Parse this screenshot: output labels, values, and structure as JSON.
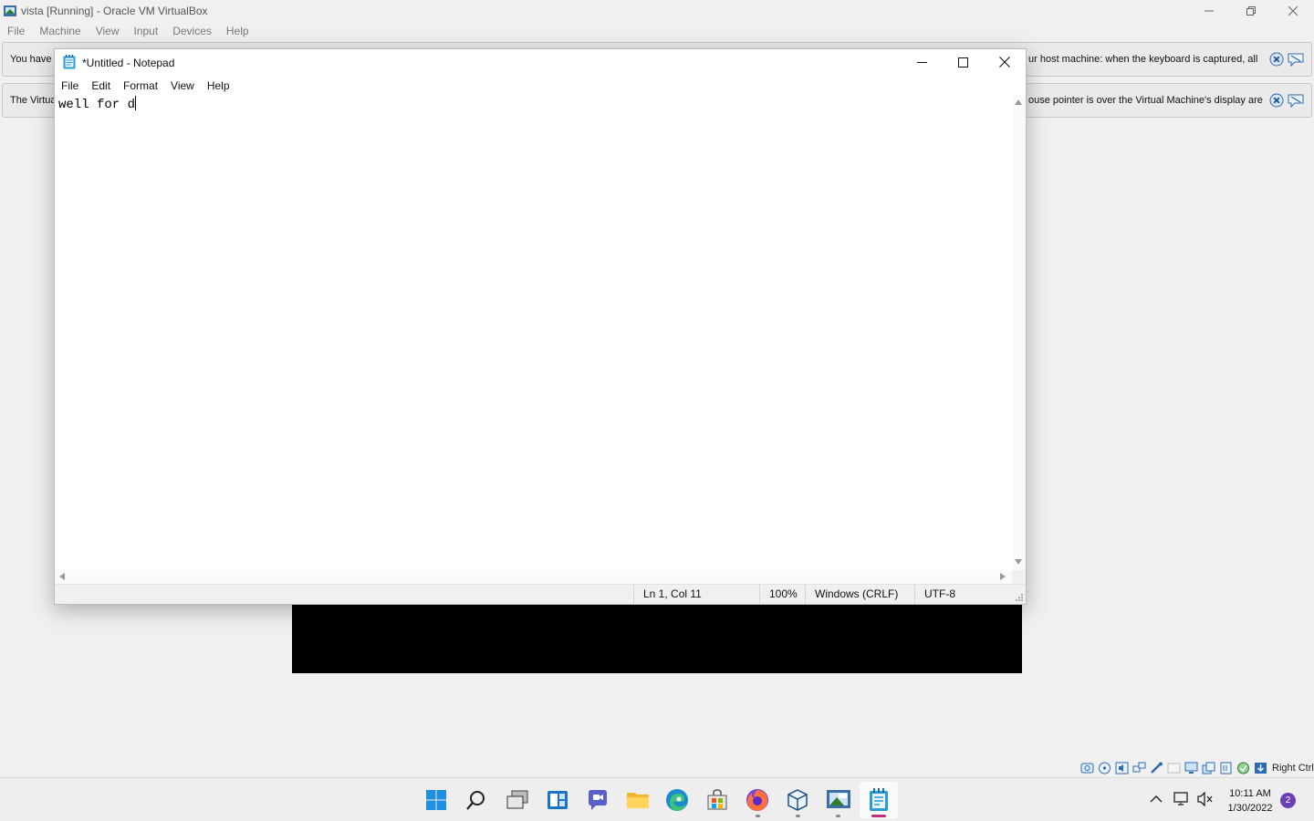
{
  "vbox": {
    "title": "vista [Running] - Oracle VM VirtualBox",
    "menu": [
      "File",
      "Machine",
      "View",
      "Input",
      "Devices",
      "Help"
    ],
    "notices": [
      {
        "left_text": "You have t",
        "right_text": "ur host machine: when the keyboard is captured, all"
      },
      {
        "left_text": "The Virtua",
        "right_text": "ouse pointer is over the Virtual Machine's display are"
      }
    ],
    "host_key": "Right Ctrl",
    "status_icons": [
      "hard-disk-icon",
      "optical-drive-icon",
      "audio-icon",
      "network-icon",
      "usb-icon",
      "shared-folder-icon",
      "display-icon",
      "recording-icon",
      "cpu-icon",
      "mouse-integration-icon",
      "keyboard-icon"
    ]
  },
  "notepad": {
    "title": "*Untitled - Notepad",
    "menu": [
      "File",
      "Edit",
      "Format",
      "View",
      "Help"
    ],
    "content": "well for d",
    "status": {
      "position": "Ln 1, Col 11",
      "zoom": "100%",
      "line_ending": "Windows (CRLF)",
      "encoding": "UTF-8"
    }
  },
  "taskbar": {
    "apps": [
      "start-icon",
      "search-icon",
      "task-view-icon",
      "widgets-icon",
      "chat-icon",
      "file-explorer-icon",
      "edge-icon",
      "store-icon",
      "firefox-icon",
      "virtualbox-icon",
      "vista-vm-icon",
      "notepad-icon"
    ],
    "clock": {
      "time": "10:11 AM",
      "date": "1/30/2022"
    },
    "notification_count": "2"
  }
}
